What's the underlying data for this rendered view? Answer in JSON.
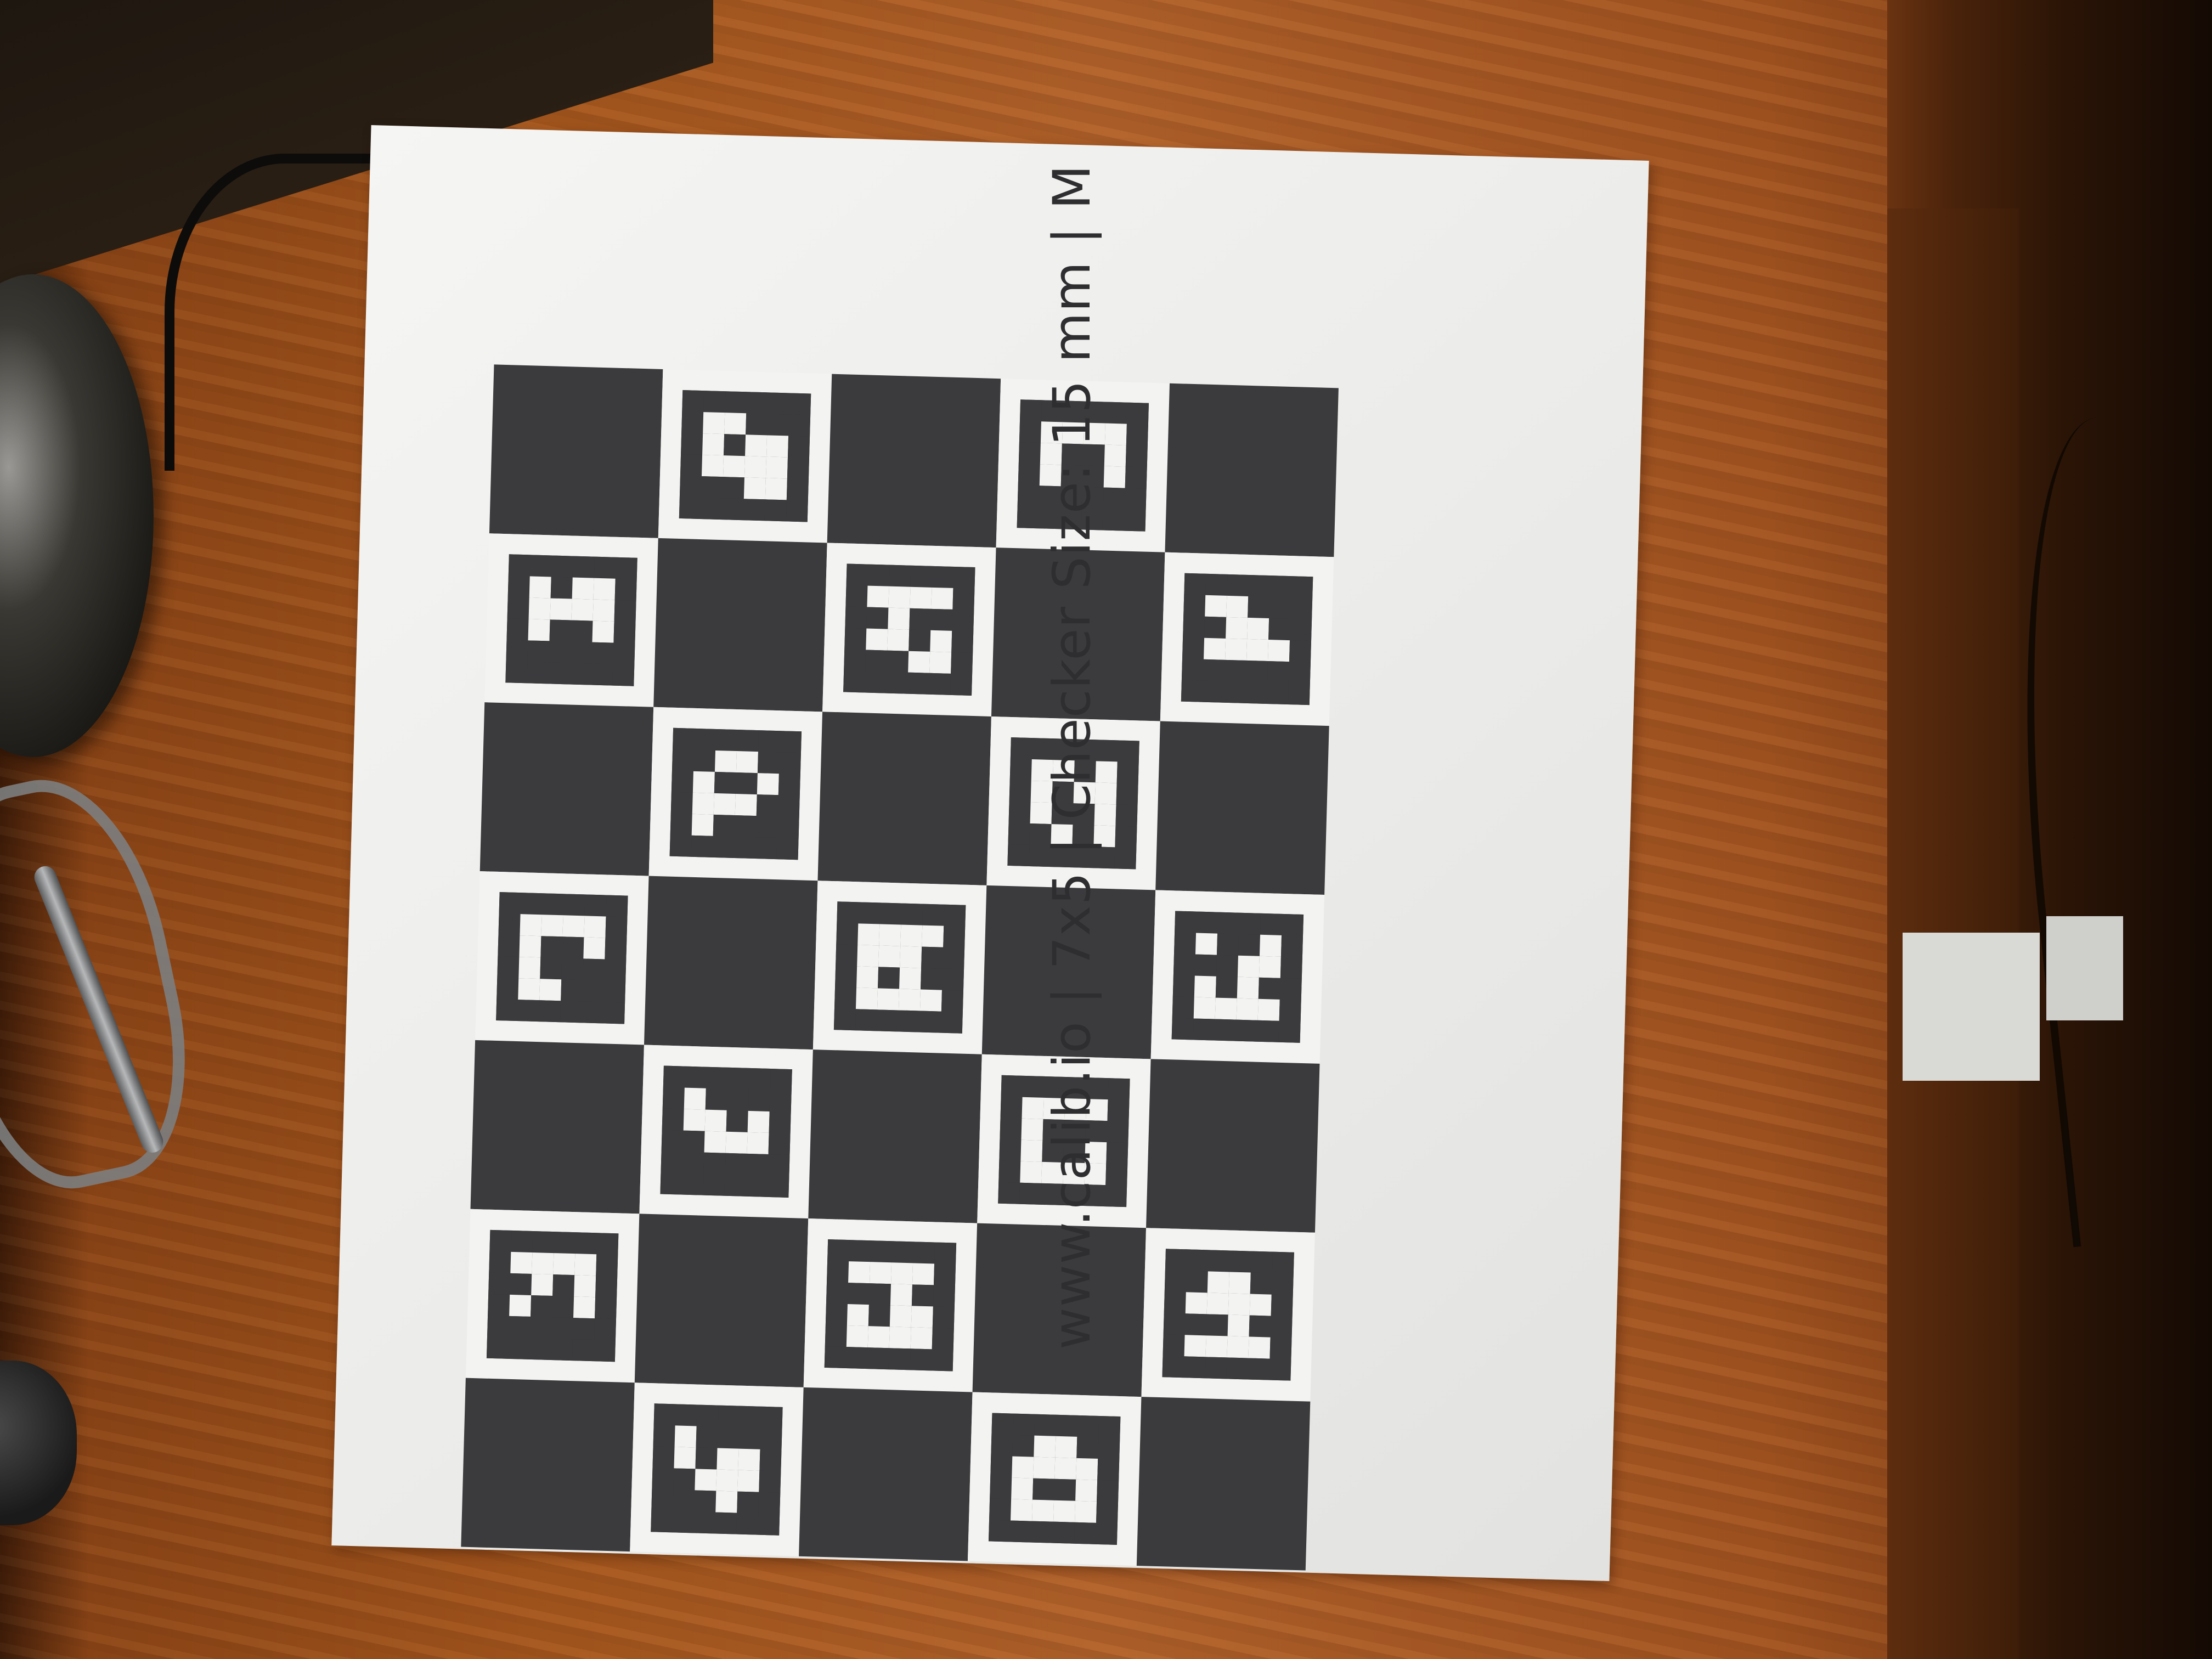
{
  "scene": {
    "description_colors": {
      "wood": "#a4561d",
      "paper": "#f0f0ee",
      "ink": "#3b3b3d"
    }
  },
  "calibration_sheet": {
    "caption": "www.calib.io | 7x5 | Checker Size: 15 mm | M",
    "rows": 7,
    "cols": 5,
    "pattern": [
      [
        "black",
        "white",
        "black",
        "white",
        "black"
      ],
      [
        "white",
        "black",
        "white",
        "black",
        "white"
      ],
      [
        "black",
        "white",
        "black",
        "white",
        "black"
      ],
      [
        "white",
        "black",
        "white",
        "black",
        "white"
      ],
      [
        "black",
        "white",
        "black",
        "white",
        "black"
      ],
      [
        "white",
        "black",
        "white",
        "black",
        "white"
      ],
      [
        "black",
        "white",
        "black",
        "white",
        "black"
      ]
    ],
    "markers": [
      [
        0,
        1,
        "......\n.##...\n.#.##.\n.####.\n...##.\n......"
      ],
      [
        0,
        3,
        "......\n.####.\n.#..#.\n.#..#.\n......\n......"
      ],
      [
        1,
        0,
        "......\n.#.##.\n.####.\n.#..#.\n......\n......"
      ],
      [
        1,
        2,
        "......\n.####.\n..#...\n.##.#.\n...##.\n......"
      ],
      [
        1,
        4,
        "......\n.##...\n..##..\n.####.\n......\n......"
      ],
      [
        2,
        1,
        "......\n..##..\n.#..#.\n.###..\n.#....\n......"
      ],
      [
        2,
        3,
        "......\n.##.#.\n.#.##.\n.#..#.\n..#.#.\n......"
      ],
      [
        3,
        0,
        "......\n.####.\n.#..#.\n.#....\n.##...\n......"
      ],
      [
        3,
        2,
        "......\n.####.\n.###..\n.#.#..\n.####.\n......"
      ],
      [
        3,
        4,
        "......\n.#..#.\n...##.\n.#.#..\n.####.\n......"
      ],
      [
        4,
        1,
        "......\n.#....\n.##.#.\n..###.\n......\n......"
      ],
      [
        4,
        3,
        "......\n.####.\n.#....\n.#..#.\n.####.\n......"
      ],
      [
        5,
        0,
        "......\n.####.\n..#.#.\n.#..#.\n......\n......"
      ],
      [
        5,
        2,
        "......\n.####.\n...#..\n.#.##.\n.####.\n......"
      ],
      [
        5,
        4,
        "......\n..##..\n.####.\n...#..\n.####.\n......"
      ],
      [
        6,
        1,
        "......\n.#....\n.#.##.\n..###.\n...#..\n......"
      ],
      [
        6,
        3,
        "......\n..##..\n.####.\n.#..#.\n.####.\n......"
      ]
    ]
  }
}
